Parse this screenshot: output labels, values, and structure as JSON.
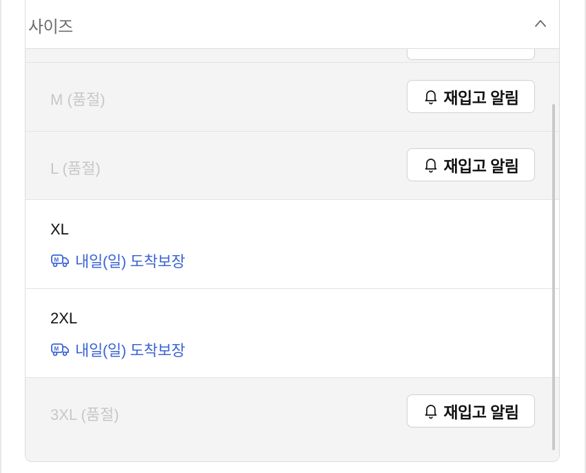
{
  "dropdown": {
    "title": "사이즈",
    "expanded": true
  },
  "options": [
    {
      "size_text": "M (품절)",
      "sold_out": true,
      "restock_button": "재입고 알림"
    },
    {
      "size_text": "L (품절)",
      "sold_out": true,
      "restock_button": "재입고 알림"
    },
    {
      "size_text": "XL",
      "sold_out": false,
      "delivery_text": "내일(일) 도착보장"
    },
    {
      "size_text": "2XL",
      "sold_out": false,
      "delivery_text": "내일(일) 도착보장"
    },
    {
      "size_text": "3XL (품절)",
      "sold_out": true,
      "restock_button": "재입고 알림"
    }
  ],
  "colors": {
    "delivery_blue": "#3a63d6",
    "soldout_bg": "#f4f4f4",
    "soldout_text": "#c7c7c7"
  },
  "icons": [
    "chevron-up-icon",
    "bell-icon",
    "truck-icon"
  ]
}
